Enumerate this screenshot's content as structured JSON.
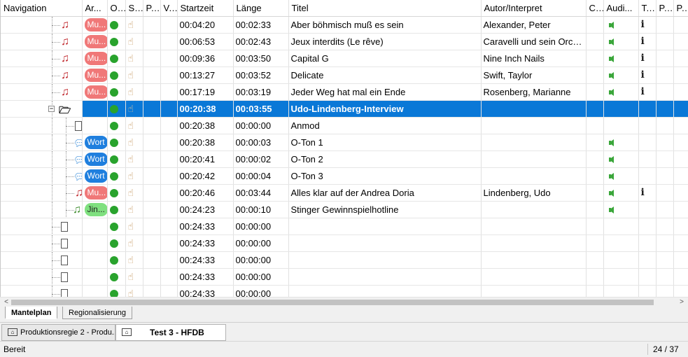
{
  "columns": {
    "navigation": "Navigation",
    "art": "Ar...",
    "on_air": "O...",
    "s": "S...",
    "p1": "P...",
    "v": "V...",
    "startzeit": "Startzeit",
    "laenge": "Länge",
    "titel": "Titel",
    "autor": "Autor/Interpret",
    "c": "C...",
    "audio": "Audi...",
    "t": "T...",
    "p2": "P...",
    "p3": "P..."
  },
  "rows": [
    {
      "nav_icon": "music-note-icon",
      "art": "Mu...",
      "art_kind": "music",
      "startzeit": "00:04:20",
      "laenge": "00:02:33",
      "titel": "Aber böhmisch muß es sein",
      "autor": "Alexander, Peter",
      "audio": true,
      "info": true
    },
    {
      "nav_icon": "music-note-icon",
      "art": "Mu...",
      "art_kind": "music",
      "startzeit": "00:06:53",
      "laenge": "00:02:43",
      "titel": "Jeux interdits (Le rêve)",
      "autor": "Caravelli und sein Orch...",
      "audio": true,
      "info": true
    },
    {
      "nav_icon": "music-note-icon",
      "art": "Mu...",
      "art_kind": "music",
      "startzeit": "00:09:36",
      "laenge": "00:03:50",
      "titel": "Capital G",
      "autor": "Nine Inch Nails",
      "audio": true,
      "info": true
    },
    {
      "nav_icon": "music-note-icon",
      "art": "Mu...",
      "art_kind": "music",
      "startzeit": "00:13:27",
      "laenge": "00:03:52",
      "titel": "Delicate",
      "autor": "Swift, Taylor",
      "audio": true,
      "info": true
    },
    {
      "nav_icon": "music-note-icon",
      "art": "Mu...",
      "art_kind": "music",
      "startzeit": "00:17:19",
      "laenge": "00:03:19",
      "titel": "Jeder Weg hat mal ein Ende",
      "autor": "Rosenberg, Marianne",
      "audio": true,
      "info": true
    },
    {
      "nav_icon": "folder-open-icon",
      "art": "",
      "art_kind": "",
      "startzeit": "00:20:38",
      "laenge": "00:03:55",
      "titel": "Udo-Lindenberg-Interview",
      "autor": "",
      "audio": false,
      "info": false,
      "selected": true,
      "expander": "−"
    },
    {
      "nav_icon": "document-icon",
      "art": "",
      "art_kind": "",
      "startzeit": "00:20:38",
      "laenge": "00:00:00",
      "titel": "Anmod",
      "autor": "",
      "audio": false,
      "info": false,
      "child": true
    },
    {
      "nav_icon": "speech-bubble-icon",
      "art": "Wort",
      "art_kind": "word",
      "startzeit": "00:20:38",
      "laenge": "00:00:03",
      "titel": "O-Ton 1",
      "autor": "",
      "audio": true,
      "info": false,
      "child": true
    },
    {
      "nav_icon": "speech-bubble-icon",
      "art": "Wort",
      "art_kind": "word",
      "startzeit": "00:20:41",
      "laenge": "00:00:02",
      "titel": "O-Ton 2",
      "autor": "",
      "audio": true,
      "info": false,
      "child": true
    },
    {
      "nav_icon": "speech-bubble-icon",
      "art": "Wort",
      "art_kind": "word",
      "startzeit": "00:20:42",
      "laenge": "00:00:04",
      "titel": "O-Ton 3",
      "autor": "",
      "audio": true,
      "info": false,
      "child": true
    },
    {
      "nav_icon": "music-note-icon",
      "art": "Mu...",
      "art_kind": "music",
      "startzeit": "00:20:46",
      "laenge": "00:03:44",
      "titel": "Alles klar auf der Andrea Doria",
      "autor": "Lindenberg, Udo",
      "audio": true,
      "info": true,
      "child": true
    },
    {
      "nav_icon": "jingle-note-icon",
      "art": "Jin...",
      "art_kind": "jingle",
      "startzeit": "00:24:23",
      "laenge": "00:00:10",
      "titel": "Stinger Gewinnspielhotline",
      "autor": "",
      "audio": true,
      "info": false,
      "child": true
    },
    {
      "nav_icon": "document-icon",
      "art": "",
      "art_kind": "",
      "startzeit": "00:24:33",
      "laenge": "00:00:00",
      "titel": "",
      "autor": "",
      "audio": false,
      "info": false
    },
    {
      "nav_icon": "document-icon",
      "art": "",
      "art_kind": "",
      "startzeit": "00:24:33",
      "laenge": "00:00:00",
      "titel": "",
      "autor": "",
      "audio": false,
      "info": false
    },
    {
      "nav_icon": "document-icon",
      "art": "",
      "art_kind": "",
      "startzeit": "00:24:33",
      "laenge": "00:00:00",
      "titel": "",
      "autor": "",
      "audio": false,
      "info": false
    },
    {
      "nav_icon": "document-icon",
      "art": "",
      "art_kind": "",
      "startzeit": "00:24:33",
      "laenge": "00:00:00",
      "titel": "",
      "autor": "",
      "audio": false,
      "info": false
    },
    {
      "nav_icon": "document-icon",
      "art": "",
      "art_kind": "",
      "startzeit": "00:24:33",
      "laenge": "00:00:00",
      "titel": "",
      "autor": "",
      "audio": false,
      "info": false
    }
  ],
  "sheet_tabs": [
    {
      "label": "Mantelplan",
      "active": true
    },
    {
      "label": "Regionalisierung",
      "active": false
    }
  ],
  "doc_tabs": [
    {
      "label": "Produktionsregie 2 - Produ...",
      "active": false
    },
    {
      "label": "Test 3 - HFDB",
      "active": true
    }
  ],
  "status": {
    "text": "Bereit",
    "count": "24 / 37"
  },
  "colors": {
    "selection": "#0a78d7",
    "music_pill": "#f07878",
    "word_pill": "#1f7fde",
    "jingle_pill": "#7fe07f",
    "on_air_dot": "#29a32d"
  }
}
